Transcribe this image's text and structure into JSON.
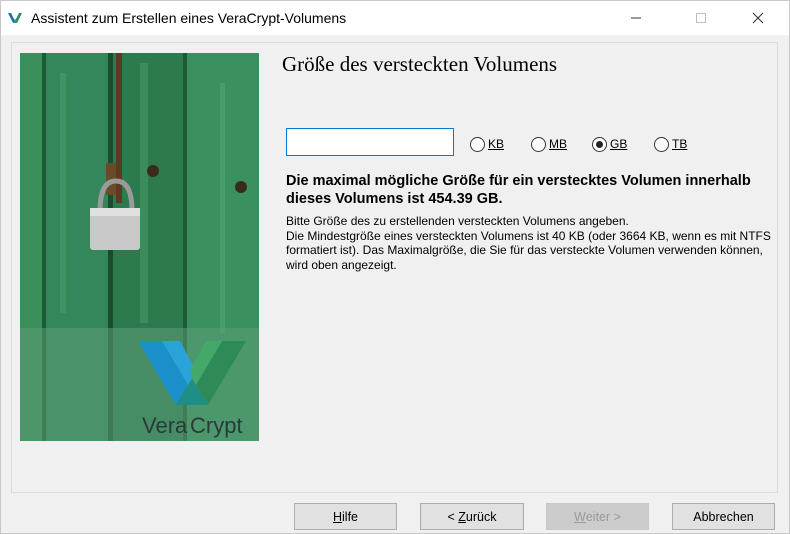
{
  "window": {
    "title": "Assistent zum Erstellen eines VeraCrypt-Volumens"
  },
  "page": {
    "title": "Größe des versteckten Volumens",
    "size_value": "",
    "units": [
      {
        "label": "KB",
        "access_key": "K",
        "rest": "B",
        "selected": false
      },
      {
        "label": "MB",
        "access_key": "M",
        "rest": "B",
        "selected": false
      },
      {
        "label": "GB",
        "access_key": "G",
        "rest": "B",
        "selected": true
      },
      {
        "label": "TB",
        "access_key": "T",
        "rest": "B",
        "selected": false
      }
    ],
    "max_size_info": "Die maximal mögliche Größe für ein verstecktes Volumen innerhalb dieses Volumens ist 454.39 GB.",
    "description": [
      "Bitte Größe des zu erstellenden versteckten Volumens angeben.",
      "Die Mindestgröße eines versteckten Volumens ist 40 KB (oder 3664 KB, wenn es mit NTFS formatiert ist). Das Maximalgröße, die Sie für das versteckte Volumen verwenden können, wird oben angezeigt."
    ]
  },
  "banner": {
    "logo_text_1": "Vera",
    "logo_text_2": "Crypt"
  },
  "buttons": {
    "help": {
      "access_key": "H",
      "rest": "ilfe"
    },
    "back": {
      "prefix": "< ",
      "access_key": "Z",
      "rest": "urück"
    },
    "next": {
      "access_key": "W",
      "rest": "eiter >"
    },
    "cancel": {
      "label": "Abbrechen"
    }
  },
  "colors": {
    "accent": "#0078d7",
    "banner_green": "#2f7a4c",
    "logo_blue": "#1a8fc9",
    "logo_green": "#2e8b57"
  }
}
